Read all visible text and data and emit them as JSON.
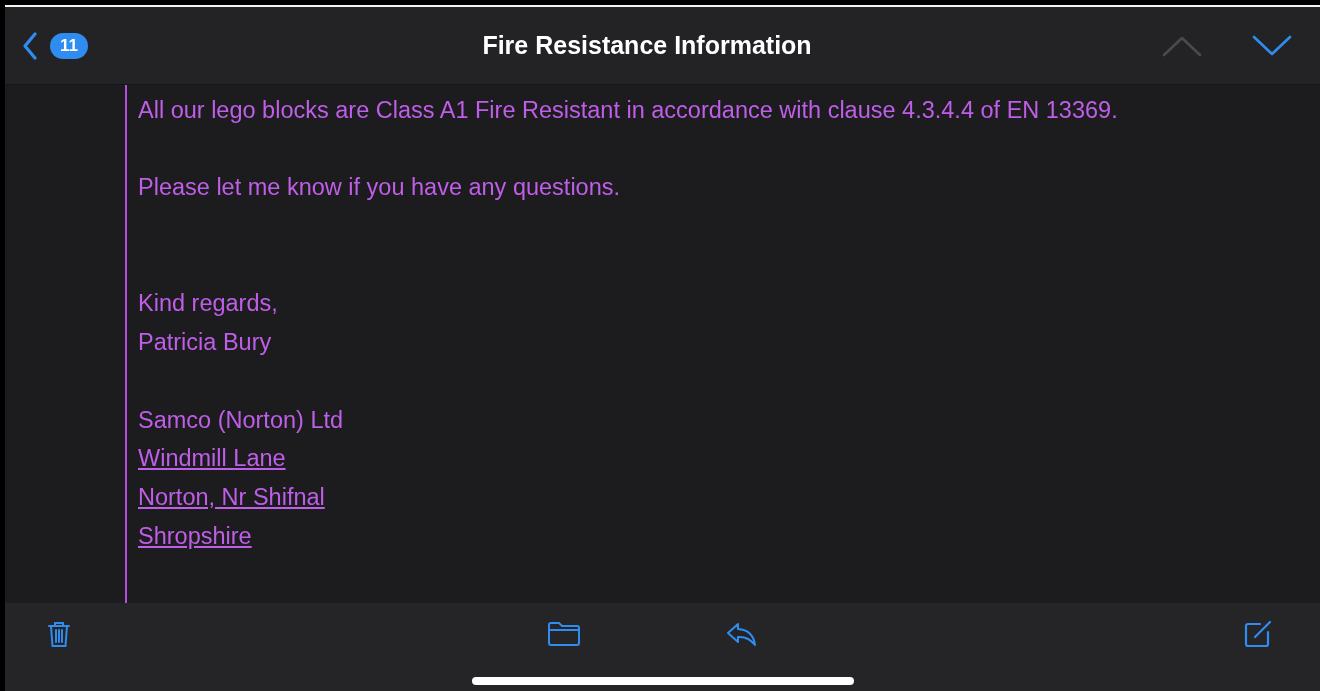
{
  "nav_bar": {
    "badge": "11",
    "title": "Fire Resistance Information",
    "previous_disabled": true,
    "next_disabled": false
  },
  "message": {
    "lines": [
      {
        "kind": "text",
        "text": "All our lego blocks are Class A1 Fire Resistant in accordance with clause 4.3.4.4 of EN 13369."
      },
      {
        "kind": "break"
      },
      {
        "kind": "text",
        "text": "Please let me know if you have any questions."
      },
      {
        "kind": "break"
      },
      {
        "kind": "break"
      },
      {
        "kind": "text",
        "text": "Kind regards,"
      },
      {
        "kind": "text",
        "text": "Patricia Bury"
      },
      {
        "kind": "break"
      },
      {
        "kind": "text",
        "text": "Samco (Norton) Ltd"
      },
      {
        "kind": "link",
        "text": "Windmill Lane"
      },
      {
        "kind": "link",
        "text": "Norton, Nr Shifnal"
      },
      {
        "kind": "link",
        "text": "Shropshire"
      }
    ]
  }
}
